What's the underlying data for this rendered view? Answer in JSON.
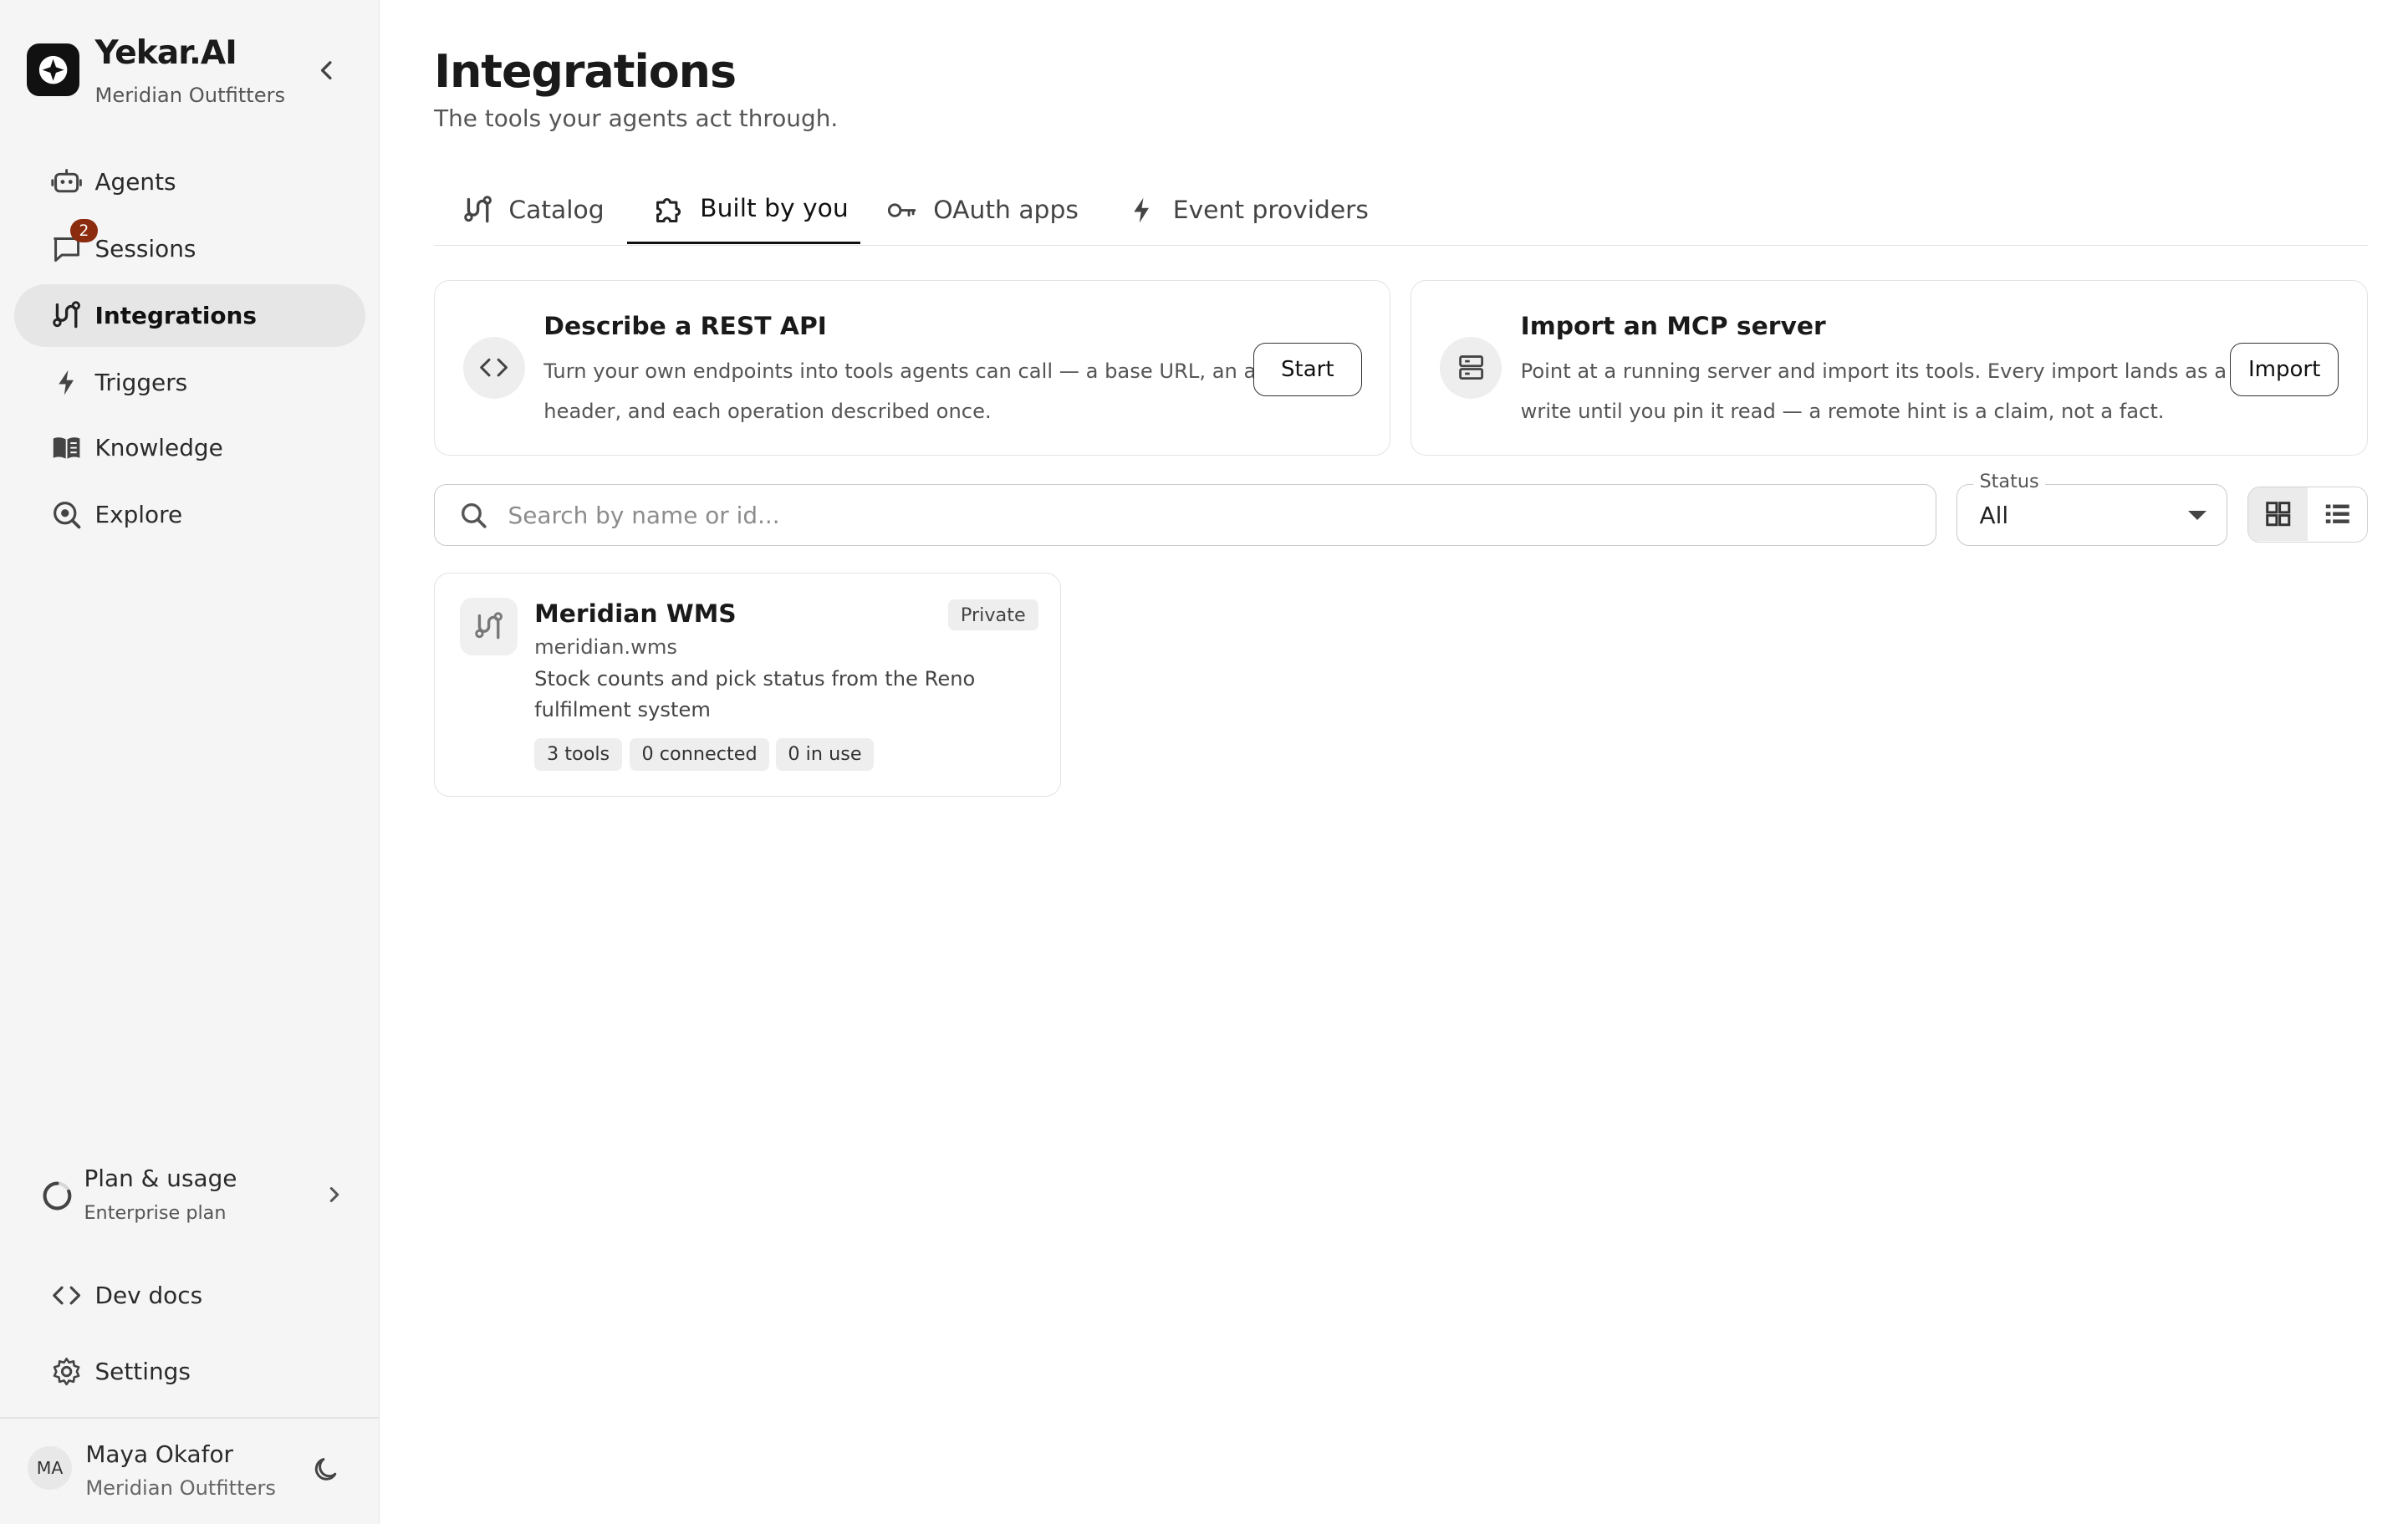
{
  "brand": {
    "name": "Yekar.AI",
    "org": "Meridian Outfitters"
  },
  "nav": {
    "items": [
      {
        "label": "Agents",
        "icon": "robot-icon"
      },
      {
        "label": "Sessions",
        "icon": "chat-icon",
        "badge": "2"
      },
      {
        "label": "Integrations",
        "icon": "integrations-icon",
        "active": true
      },
      {
        "label": "Triggers",
        "icon": "bolt-icon"
      },
      {
        "label": "Knowledge",
        "icon": "book-icon"
      },
      {
        "label": "Explore",
        "icon": "explore-icon"
      }
    ]
  },
  "plan": {
    "title": "Plan & usage",
    "subtitle": "Enterprise plan"
  },
  "footer": {
    "dev_docs": "Dev docs",
    "settings": "Settings"
  },
  "user": {
    "initials": "MA",
    "name": "Maya Okafor",
    "org": "Meridian Outfitters"
  },
  "page": {
    "title": "Integrations",
    "subtitle": "The tools your agents act through."
  },
  "tabs": [
    {
      "label": "Catalog",
      "icon": "integrations-icon"
    },
    {
      "label": "Built by you",
      "icon": "puzzle-icon",
      "active": true
    },
    {
      "label": "OAuth apps",
      "icon": "key-icon"
    },
    {
      "label": "Event providers",
      "icon": "bolt-icon"
    }
  ],
  "actions": {
    "rest": {
      "title": "Describe a REST API",
      "desc_line1": "Turn your own endpoints into tools agents can call — a base URL, an auth",
      "desc_line2": "header, and each operation described once.",
      "button": "Start"
    },
    "mcp": {
      "title": "Import an MCP server",
      "desc_line1": "Point at a running server and import its tools. Every import lands as a",
      "desc_line2": "write until you pin it read — a remote hint is a claim, not a fact.",
      "button": "Import"
    }
  },
  "search": {
    "placeholder": "Search by name or id..."
  },
  "status_filter": {
    "label": "Status",
    "value": "All"
  },
  "integrations": [
    {
      "name": "Meridian WMS",
      "id": "meridian.wms",
      "desc_line1": "Stock counts and pick status from the Reno",
      "desc_line2": "fulfilment system",
      "visibility": "Private",
      "tools": "3 tools",
      "connected": "0 connected",
      "in_use": "0 in use"
    }
  ]
}
